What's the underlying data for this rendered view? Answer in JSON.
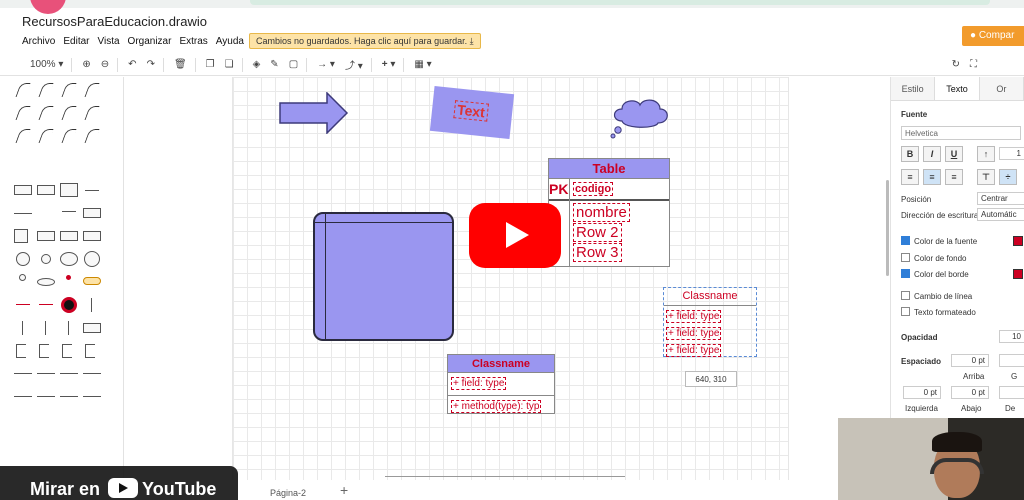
{
  "app": {
    "filename": "RecursosParaEducacion.drawio",
    "share_label": "Compar"
  },
  "menu": [
    "Archivo",
    "Editar",
    "Vista",
    "Organizar",
    "Extras",
    "Ayuda"
  ],
  "unsaved_banner": "Cambios no guardados. Haga clic aquí para guardar.",
  "toolbar": {
    "zoom": "100%"
  },
  "canvas": {
    "text_shape": "Text",
    "table": {
      "title": "Table",
      "pk": "PK",
      "pk_field": "codigo",
      "rows": [
        "nombre",
        "Row 2",
        "Row 3"
      ]
    },
    "class1": {
      "title": "Classname",
      "field": "+ field: type",
      "method": "+ method(type): typ"
    },
    "class2": {
      "title": "Classname",
      "fields": [
        "+ field: type",
        "+ field: type",
        "+ field: type"
      ]
    },
    "coord_tooltip": "640, 310"
  },
  "pages": {
    "page2": "Página-2",
    "add": "+"
  },
  "right_panel": {
    "tabs": [
      "Estilo",
      "Texto",
      "Or"
    ],
    "font_section": "Fuente",
    "font_name": "Helvetica",
    "font_size": "1",
    "position_label": "Posición",
    "position_value": "Centrar",
    "direction_label": "Dirección de escritura",
    "direction_value": "Automátic",
    "checks": [
      {
        "label": "Color de la fuente",
        "checked": true
      },
      {
        "label": "Color de fondo",
        "checked": false
      },
      {
        "label": "Color del borde",
        "checked": true
      },
      {
        "label": "Cambio de línea",
        "checked": false
      },
      {
        "label": "Texto formateado",
        "checked": false
      }
    ],
    "opacity_label": "Opacidad",
    "opacity_value": "10",
    "spacing_label": "Espaciado",
    "spacing_top": "0 pt",
    "top_label": "Arriba",
    "g_label": "G",
    "spacing_left": "0 pt",
    "spacing_bottom": "0 pt",
    "left_label": "Izquierda",
    "bottom_label": "Abajo",
    "de_label": "De"
  },
  "overlay": {
    "watch_label": "Mirar en",
    "yt_label": "YouTube"
  }
}
